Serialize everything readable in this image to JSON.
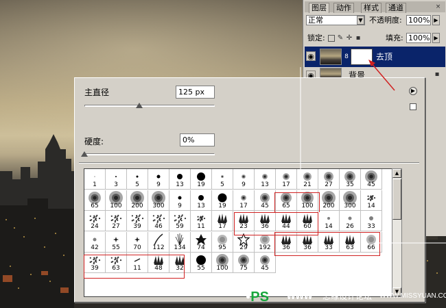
{
  "layers_panel": {
    "tabs": [
      "图层",
      "动作",
      "样式",
      "通道"
    ],
    "close_glyph": "×",
    "blend_mode": "正常",
    "opacity_label": "不透明度:",
    "opacity_value": "100%",
    "lock_label": "锁定:",
    "fill_label": "填充:",
    "fill_value": "100%",
    "dropdown_arrow": "▼",
    "menu_arrow": "▶",
    "layers": [
      {
        "name": "去顶",
        "selected": true,
        "has_mask": true
      },
      {
        "name": "背景",
        "selected": false,
        "has_mask": false
      }
    ],
    "eye_glyph": "👁",
    "link_glyph": "8"
  },
  "brush_picker": {
    "master_diameter_label": "主直径",
    "master_diameter_value": "125 px",
    "master_diameter_slider": 0.42,
    "hardness_label": "硬度:",
    "hardness_value": "0%",
    "hardness_slider": 0.0,
    "menu_glyph": "▶",
    "scroll_up": "▲",
    "scroll_down": "▼",
    "rows": [
      [
        {
          "n": "1",
          "t": "hard",
          "s": 1
        },
        {
          "n": "3",
          "t": "hard",
          "s": 2
        },
        {
          "n": "5",
          "t": "hard",
          "s": 3
        },
        {
          "n": "9",
          "t": "hard",
          "s": 5
        },
        {
          "n": "13",
          "t": "hard",
          "s": 8
        },
        {
          "n": "19",
          "t": "hard",
          "s": 12
        },
        {
          "n": "5",
          "t": "soft",
          "s": 4
        },
        {
          "n": "9",
          "t": "soft",
          "s": 6
        },
        {
          "n": "13",
          "t": "soft",
          "s": 8
        },
        {
          "n": "17",
          "t": "soft",
          "s": 10
        },
        {
          "n": "21",
          "t": "soft",
          "s": 12
        },
        {
          "n": "27",
          "t": "soft",
          "s": 14
        },
        {
          "n": "35",
          "t": "soft",
          "s": 16
        },
        {
          "n": "45",
          "t": "soft",
          "s": 18
        }
      ],
      [
        {
          "n": "65",
          "t": "soft",
          "s": 18
        },
        {
          "n": "100",
          "t": "soft",
          "s": 20
        },
        {
          "n": "200",
          "t": "soft",
          "s": 20
        },
        {
          "n": "300",
          "t": "soft",
          "s": 20
        },
        {
          "n": "9",
          "t": "hard",
          "s": 5
        },
        {
          "n": "13",
          "t": "hard",
          "s": 8
        },
        {
          "n": "19",
          "t": "hard",
          "s": 13
        },
        {
          "n": "17",
          "t": "soft",
          "s": 8
        },
        {
          "n": "45",
          "t": "soft",
          "s": 14
        },
        {
          "n": "65",
          "t": "soft",
          "s": 16
        },
        {
          "n": "100",
          "t": "soft",
          "s": 18
        },
        {
          "n": "200",
          "t": "soft",
          "s": 20
        },
        {
          "n": "300",
          "t": "soft",
          "s": 20
        },
        {
          "n": "14",
          "t": "splat",
          "s": 10
        }
      ],
      [
        {
          "n": "24",
          "t": "splat",
          "s": 14
        },
        {
          "n": "27",
          "t": "splat",
          "s": 14
        },
        {
          "n": "39",
          "t": "splat",
          "s": 16
        },
        {
          "n": "46",
          "t": "splat",
          "s": 16
        },
        {
          "n": "59",
          "t": "splat",
          "s": 16
        },
        {
          "n": "11",
          "t": "splat",
          "s": 10
        },
        {
          "n": "17",
          "t": "grass",
          "s": 16
        },
        {
          "n": "23",
          "t": "grass",
          "s": 16
        },
        {
          "n": "36",
          "t": "grass",
          "s": 16
        },
        {
          "n": "44",
          "t": "grass",
          "s": 16
        },
        {
          "n": "60",
          "t": "grass",
          "s": 16
        },
        {
          "n": "14",
          "t": "dot",
          "s": 4
        },
        {
          "n": "26",
          "t": "dot",
          "s": 5
        },
        {
          "n": "33",
          "t": "dot",
          "s": 6
        }
      ],
      [
        {
          "n": "42",
          "t": "dot",
          "s": 5
        },
        {
          "n": "55",
          "t": "star",
          "s": 8
        },
        {
          "n": "70",
          "t": "star",
          "s": 8
        },
        {
          "n": "112",
          "t": "stroke",
          "s": 16
        },
        {
          "n": "134",
          "t": "blade",
          "s": 16
        },
        {
          "n": "74",
          "t": "leaf",
          "s": 16
        },
        {
          "n": "95",
          "t": "fuzzy",
          "s": 16
        },
        {
          "n": "29",
          "t": "outline-star",
          "s": 16
        },
        {
          "n": "192",
          "t": "fuzzy",
          "s": 16
        },
        {
          "n": "36",
          "t": "grass",
          "s": 16
        },
        {
          "n": "36",
          "t": "grass",
          "s": 16
        },
        {
          "n": "33",
          "t": "grass",
          "s": 16
        },
        {
          "n": "63",
          "t": "grass",
          "s": 16
        },
        {
          "n": "66",
          "t": "fuzzy",
          "s": 16
        }
      ],
      [
        {
          "n": "39",
          "t": "splat",
          "s": 14
        },
        {
          "n": "63",
          "t": "splat",
          "s": 14
        },
        {
          "n": "11",
          "t": "stroke-small",
          "s": 10
        },
        {
          "n": "48",
          "t": "grass",
          "s": 16
        },
        {
          "n": "32",
          "t": "grass",
          "s": 16
        },
        {
          "n": "55",
          "t": "hard",
          "s": 14
        },
        {
          "n": "100",
          "t": "soft",
          "s": 18
        },
        {
          "n": "75",
          "t": "soft",
          "s": 16
        },
        {
          "n": "45",
          "t": "soft",
          "s": 14
        }
      ]
    ]
  },
  "watermark": {
    "logo": "PS",
    "www": "www",
    "site_cn": "思缘设计论坛",
    "url": "WWW.MISSYUAN.COM"
  }
}
